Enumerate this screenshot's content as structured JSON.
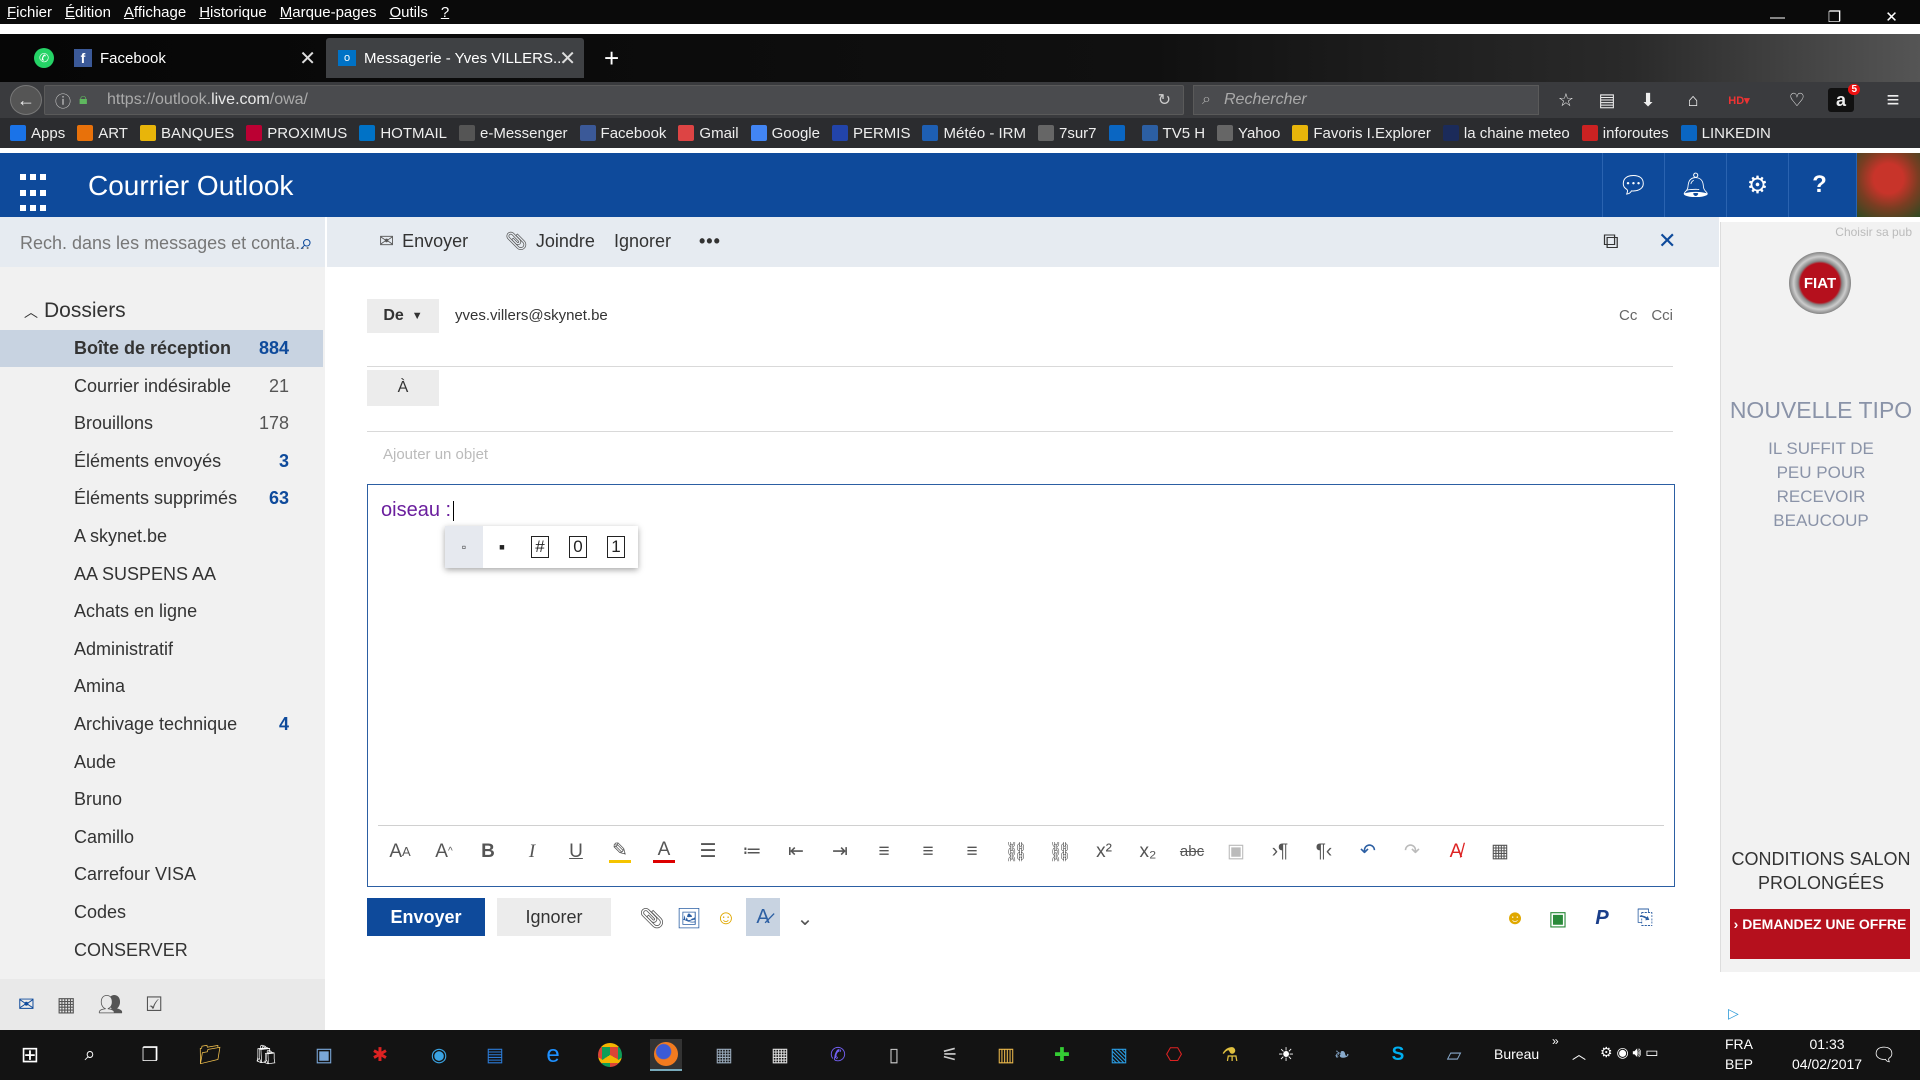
{
  "browser": {
    "menu": [
      {
        "u": "F",
        "rest": "ichier"
      },
      {
        "u": "É",
        "rest": "dition"
      },
      {
        "u": "A",
        "rest": "ffichage"
      },
      {
        "u": "H",
        "rest": "istorique"
      },
      {
        "u": "M",
        "rest": "arque-pages"
      },
      {
        "u": "O",
        "rest": "utils"
      },
      {
        "u": "?",
        "rest": ""
      }
    ],
    "tabs": [
      {
        "title": "Facebook",
        "icon": "facebook-icon"
      },
      {
        "title": "Messagerie - Yves VILLERS...",
        "icon": "outlook-icon"
      }
    ],
    "url_prefix": "https://outlook.",
    "url_host": "live.com",
    "url_path": "/owa/",
    "search_placeholder": "Rechercher",
    "amazon_badge": "5",
    "bookmarks": [
      "Apps",
      "ART",
      "BANQUES",
      "PROXIMUS",
      "HOTMAIL",
      "e-Messenger",
      "Facebook",
      "Gmail",
      "Google",
      "PERMIS",
      "Météo - IRM",
      "7sur7",
      "",
      "TV5 H",
      "Yahoo",
      "Favoris I.Explorer",
      "la chaine meteo",
      "inforoutes",
      "LINKEDIN"
    ]
  },
  "owa": {
    "app_title": "Courrier Outlook",
    "search_placeholder": "Rech. dans les messages et conta...",
    "folders_heading": "Dossiers",
    "folders": [
      {
        "name": "Boîte de réception",
        "count": "884",
        "selected": true
      },
      {
        "name": "Courrier indésirable",
        "count": "21"
      },
      {
        "name": "Brouillons",
        "count": "178"
      },
      {
        "name": "Éléments envoyés",
        "count": "3",
        "blue": true
      },
      {
        "name": "Éléments supprimés",
        "count": "63",
        "blue": true
      },
      {
        "name": "A skynet.be",
        "count": ""
      },
      {
        "name": "AA SUSPENS AA",
        "count": ""
      },
      {
        "name": "Achats en ligne",
        "count": ""
      },
      {
        "name": "Administratif",
        "count": ""
      },
      {
        "name": "Amina",
        "count": ""
      },
      {
        "name": "Archivage technique",
        "count": "4",
        "blue": true
      },
      {
        "name": "Aude",
        "count": ""
      },
      {
        "name": "Bruno",
        "count": ""
      },
      {
        "name": "Camillo",
        "count": ""
      },
      {
        "name": "Carrefour VISA",
        "count": ""
      },
      {
        "name": "Codes",
        "count": ""
      },
      {
        "name": "CONSERVER",
        "count": ""
      }
    ]
  },
  "compose": {
    "send": "Envoyer",
    "attach": "Joindre",
    "discard": "Ignorer",
    "from_label": "De",
    "from_address": "yves.villers@skynet.be",
    "cc": "Cc",
    "bcc": "Cci",
    "to_label": "À",
    "subject_placeholder": "Ajouter un objet",
    "body_text": "oiseau :",
    "autocomplete": [
      "▫",
      "▪",
      "#",
      "0",
      "1"
    ],
    "send_button": "Envoyer",
    "discard_button": "Ignorer"
  },
  "ad": {
    "label": "Choisir sa pub",
    "brand": "FIAT",
    "title": "NOUVELLE TIPO",
    "subtitle": "IL SUFFIT DE PEU POUR RECEVOIR BEAUCOUP",
    "conditions": "CONDITIONS SALON PROLONGÉES",
    "cta": "› DEMANDEZ UNE OFFRE"
  },
  "taskbar": {
    "desktop_label": "Bureau",
    "lang_top": "FRA",
    "lang_bottom": "BEP",
    "time": "01:33",
    "date": "04/02/2017"
  }
}
